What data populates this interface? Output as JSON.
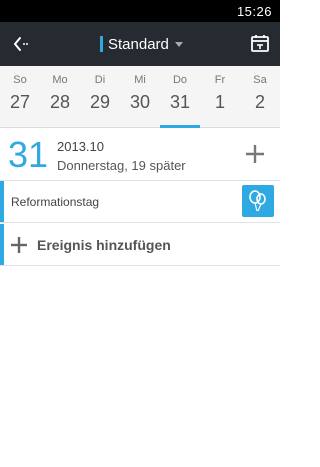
{
  "status_bar": {
    "time": "15:26"
  },
  "app_bar": {
    "title": "Standard",
    "accent_color": "#2fa9e1"
  },
  "week": {
    "days": [
      {
        "name": "So",
        "num": "27"
      },
      {
        "name": "Mo",
        "num": "28"
      },
      {
        "name": "Di",
        "num": "29"
      },
      {
        "name": "Mi",
        "num": "30"
      },
      {
        "name": "Do",
        "num": "31"
      },
      {
        "name": "Fr",
        "num": "1"
      },
      {
        "name": "Sa",
        "num": "2"
      }
    ],
    "selected_index": 4
  },
  "date_header": {
    "day": "31",
    "month": "2013.10",
    "subtitle": "Donnerstag, 19 später"
  },
  "events": [
    {
      "title": "Reformationstag",
      "icon": "balloon-icon"
    }
  ],
  "add_event": {
    "label": "Ereignis hinzufügen"
  },
  "icons": {
    "back": "back-arrow-icon",
    "today": "calendar-today-icon",
    "add": "plus-icon"
  }
}
